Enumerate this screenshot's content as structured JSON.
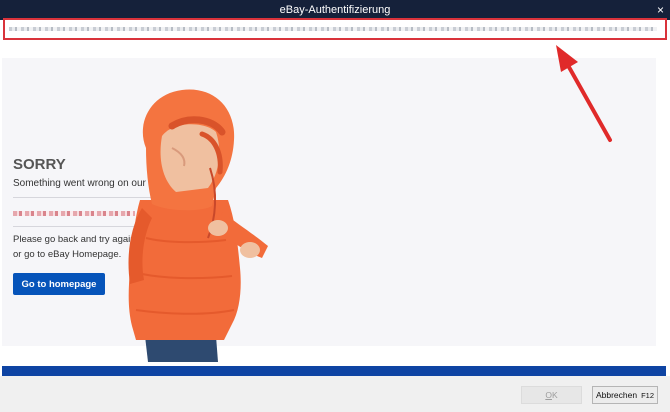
{
  "window": {
    "title": "eBay-Authentifizierung",
    "close_glyph": "×"
  },
  "error_page": {
    "heading": "SORRY",
    "message": "Something went wrong on our end.",
    "help_line1": "Please go back and try again",
    "help_line2": "or go to eBay Homepage.",
    "homepage_button": "Go to homepage"
  },
  "footer": {
    "ok_underlined": "O",
    "ok_rest": "K",
    "cancel_label": "Abbrechen",
    "cancel_shortcut": "F12"
  },
  "colors": {
    "accent": "#0654ba",
    "titlebar": "#15213a",
    "highlight": "#d9333b"
  }
}
